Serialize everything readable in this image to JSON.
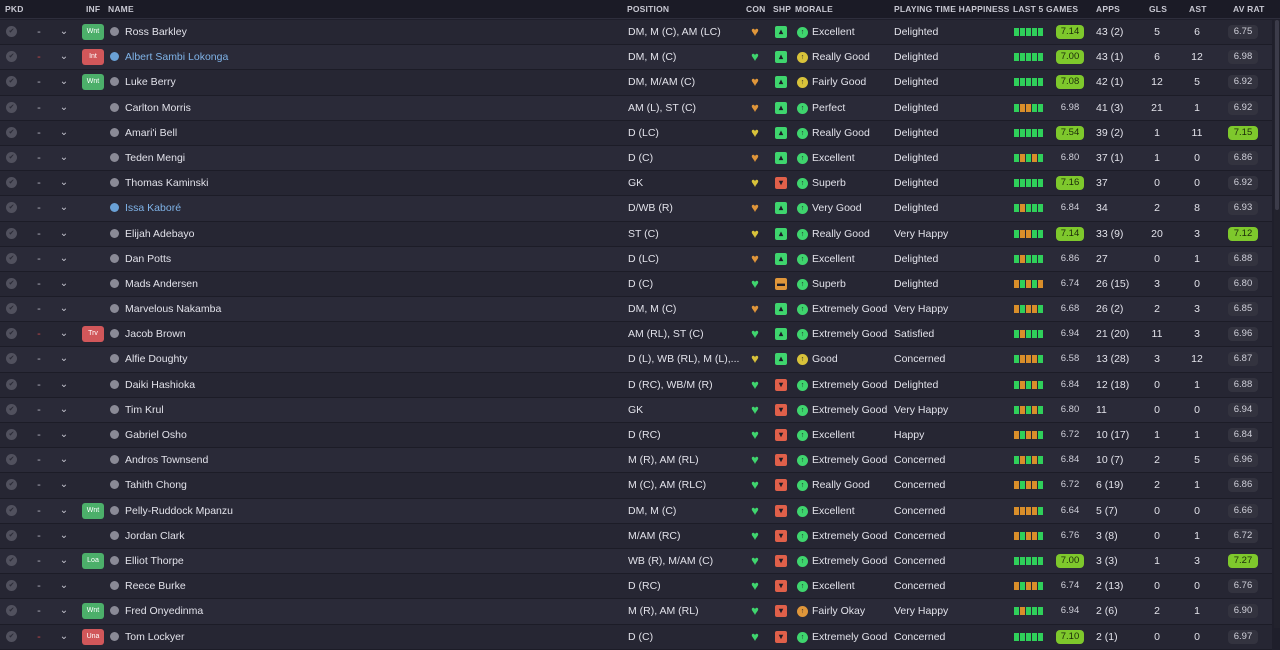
{
  "headers": {
    "pkd": "PKD",
    "inf": "INF",
    "name": "NAME",
    "position": "POSITION",
    "con": "CON",
    "shp": "SHP",
    "morale": "MORALE",
    "pth": "PLAYING TIME HAPPINESS",
    "last5": "LAST 5 GAMES",
    "apps": "APPS",
    "gls": "GLS",
    "ast": "AST",
    "avrat": "AV RAT"
  },
  "colors": {
    "form_green": "#2fd05a",
    "form_orange": "#d98e2a",
    "rating_green": "#7ec82c",
    "inf_green": "#4caf6a",
    "inf_red": "#d1575a",
    "link_blue": "#7fb3e8"
  },
  "players": [
    {
      "dash": "-",
      "dash_red": false,
      "inf": "Wnt",
      "inf_color": "green",
      "name": "Ross Barkley",
      "name_blue": false,
      "position": "DM, M (C), AM (LC)",
      "con": "orange",
      "shp": "green",
      "morale_icon": "green",
      "morale": "Excellent",
      "pth": "Delighted",
      "form": [
        "g",
        "g",
        "g",
        "g",
        "g"
      ],
      "last5": "7.14",
      "last5_green": true,
      "apps": "43 (2)",
      "gls": "5",
      "ast": "6",
      "avrat": "6.75",
      "avrat_green": false
    },
    {
      "dash": "-",
      "dash_red": true,
      "inf": "Int",
      "inf_color": "red",
      "name": "Albert Sambi Lokonga",
      "name_blue": true,
      "position": "DM, M (C)",
      "con": "green",
      "shp": "green",
      "morale_icon": "yellow",
      "morale": "Really Good",
      "pth": "Delighted",
      "form": [
        "g",
        "g",
        "g",
        "g",
        "g"
      ],
      "last5": "7.00",
      "last5_green": true,
      "apps": "43 (1)",
      "gls": "6",
      "ast": "12",
      "avrat": "6.98",
      "avrat_green": false
    },
    {
      "dash": "-",
      "dash_red": false,
      "inf": "Wnt",
      "inf_color": "green",
      "name": "Luke Berry",
      "name_blue": false,
      "position": "DM, M/AM (C)",
      "con": "orange",
      "shp": "green",
      "morale_icon": "yellow",
      "morale": "Fairly Good",
      "pth": "Delighted",
      "form": [
        "g",
        "g",
        "g",
        "g",
        "g"
      ],
      "last5": "7.08",
      "last5_green": true,
      "apps": "42 (1)",
      "gls": "12",
      "ast": "5",
      "avrat": "6.92",
      "avrat_green": false
    },
    {
      "dash": "-",
      "dash_red": false,
      "inf": "",
      "inf_color": "",
      "name": "Carlton Morris",
      "name_blue": false,
      "position": "AM (L), ST (C)",
      "con": "orange",
      "shp": "green",
      "morale_icon": "green",
      "morale": "Perfect",
      "pth": "Delighted",
      "form": [
        "g",
        "o",
        "o",
        "g",
        "g"
      ],
      "last5": "6.98",
      "last5_green": false,
      "apps": "41 (3)",
      "gls": "21",
      "ast": "1",
      "avrat": "6.92",
      "avrat_green": false
    },
    {
      "dash": "-",
      "dash_red": false,
      "inf": "",
      "inf_color": "",
      "name": "Amari'i Bell",
      "name_blue": false,
      "position": "D (LC)",
      "con": "yellow",
      "shp": "green",
      "morale_icon": "green",
      "morale": "Really Good",
      "pth": "Delighted",
      "form": [
        "g",
        "g",
        "g",
        "g",
        "g"
      ],
      "last5": "7.54",
      "last5_green": true,
      "apps": "39 (2)",
      "gls": "1",
      "ast": "11",
      "avrat": "7.15",
      "avrat_green": true
    },
    {
      "dash": "-",
      "dash_red": false,
      "inf": "",
      "inf_color": "",
      "name": "Teden Mengi",
      "name_blue": false,
      "position": "D (C)",
      "con": "orange",
      "shp": "green",
      "morale_icon": "green",
      "morale": "Excellent",
      "pth": "Delighted",
      "form": [
        "g",
        "o",
        "g",
        "o",
        "g"
      ],
      "last5": "6.80",
      "last5_green": false,
      "apps": "37 (1)",
      "gls": "1",
      "ast": "0",
      "avrat": "6.86",
      "avrat_green": false
    },
    {
      "dash": "-",
      "dash_red": false,
      "inf": "",
      "inf_color": "",
      "name": "Thomas Kaminski",
      "name_blue": false,
      "position": "GK",
      "con": "yellow",
      "shp": "red",
      "morale_icon": "green",
      "morale": "Superb",
      "pth": "Delighted",
      "form": [
        "g",
        "g",
        "g",
        "g",
        "g"
      ],
      "last5": "7.16",
      "last5_green": true,
      "apps": "37",
      "gls": "0",
      "ast": "0",
      "avrat": "6.92",
      "avrat_green": false
    },
    {
      "dash": "-",
      "dash_red": false,
      "inf": "",
      "inf_color": "",
      "name": "Issa Kaboré",
      "name_blue": true,
      "position": "D/WB (R)",
      "con": "orange",
      "shp": "green",
      "morale_icon": "green",
      "morale": "Very Good",
      "pth": "Delighted",
      "form": [
        "g",
        "o",
        "g",
        "g",
        "g"
      ],
      "last5": "6.84",
      "last5_green": false,
      "apps": "34",
      "gls": "2",
      "ast": "8",
      "avrat": "6.93",
      "avrat_green": false
    },
    {
      "dash": "-",
      "dash_red": false,
      "inf": "",
      "inf_color": "",
      "name": "Elijah Adebayo",
      "name_blue": false,
      "position": "ST (C)",
      "con": "yellow",
      "shp": "green",
      "morale_icon": "green",
      "morale": "Really Good",
      "pth": "Very Happy",
      "form": [
        "g",
        "o",
        "o",
        "g",
        "g"
      ],
      "last5": "7.14",
      "last5_green": true,
      "apps": "33 (9)",
      "gls": "20",
      "ast": "3",
      "avrat": "7.12",
      "avrat_green": true
    },
    {
      "dash": "-",
      "dash_red": false,
      "inf": "",
      "inf_color": "",
      "name": "Dan Potts",
      "name_blue": false,
      "position": "D (LC)",
      "con": "orange",
      "shp": "green",
      "morale_icon": "green",
      "morale": "Excellent",
      "pth": "Delighted",
      "form": [
        "g",
        "o",
        "g",
        "g",
        "g"
      ],
      "last5": "6.86",
      "last5_green": false,
      "apps": "27",
      "gls": "0",
      "ast": "1",
      "avrat": "6.88",
      "avrat_green": false
    },
    {
      "dash": "-",
      "dash_red": false,
      "inf": "",
      "inf_color": "",
      "name": "Mads Andersen",
      "name_blue": false,
      "position": "D (C)",
      "con": "green",
      "shp": "orange",
      "morale_icon": "green",
      "morale": "Superb",
      "pth": "Delighted",
      "form": [
        "o",
        "g",
        "o",
        "g",
        "o"
      ],
      "last5": "6.74",
      "last5_green": false,
      "apps": "26 (15)",
      "gls": "3",
      "ast": "0",
      "avrat": "6.80",
      "avrat_green": false
    },
    {
      "dash": "-",
      "dash_red": false,
      "inf": "",
      "inf_color": "",
      "name": "Marvelous Nakamba",
      "name_blue": false,
      "position": "DM, M (C)",
      "con": "orange",
      "shp": "green",
      "morale_icon": "green",
      "morale": "Extremely Good",
      "pth": "Very Happy",
      "form": [
        "o",
        "g",
        "o",
        "o",
        "g"
      ],
      "last5": "6.68",
      "last5_green": false,
      "apps": "26 (2)",
      "gls": "2",
      "ast": "3",
      "avrat": "6.85",
      "avrat_green": false
    },
    {
      "dash": "-",
      "dash_red": true,
      "inf": "Trv",
      "inf_color": "red",
      "name": "Jacob Brown",
      "name_blue": false,
      "position": "AM (RL), ST (C)",
      "con": "green",
      "shp": "green",
      "morale_icon": "green",
      "morale": "Extremely Good",
      "pth": "Satisfied",
      "form": [
        "g",
        "o",
        "g",
        "g",
        "g"
      ],
      "last5": "6.94",
      "last5_green": false,
      "apps": "21 (20)",
      "gls": "11",
      "ast": "3",
      "avrat": "6.96",
      "avrat_green": false
    },
    {
      "dash": "-",
      "dash_red": false,
      "inf": "",
      "inf_color": "",
      "name": "Alfie Doughty",
      "name_blue": false,
      "position": "D (L), WB (RL), M (L),...",
      "con": "yellow",
      "shp": "green",
      "morale_icon": "yellow",
      "morale": "Good",
      "pth": "Concerned",
      "form": [
        "g",
        "o",
        "o",
        "o",
        "g"
      ],
      "last5": "6.58",
      "last5_green": false,
      "apps": "13 (28)",
      "gls": "3",
      "ast": "12",
      "avrat": "6.87",
      "avrat_green": false
    },
    {
      "dash": "-",
      "dash_red": false,
      "inf": "",
      "inf_color": "",
      "name": "Daiki Hashioka",
      "name_blue": false,
      "position": "D (RC), WB/M (R)",
      "con": "green",
      "shp": "red",
      "morale_icon": "green",
      "morale": "Extremely Good",
      "pth": "Delighted",
      "form": [
        "g",
        "o",
        "g",
        "o",
        "g"
      ],
      "last5": "6.84",
      "last5_green": false,
      "apps": "12 (18)",
      "gls": "0",
      "ast": "1",
      "avrat": "6.88",
      "avrat_green": false
    },
    {
      "dash": "-",
      "dash_red": false,
      "inf": "",
      "inf_color": "",
      "name": "Tim Krul",
      "name_blue": false,
      "position": "GK",
      "con": "green",
      "shp": "red",
      "morale_icon": "green",
      "morale": "Extremely Good",
      "pth": "Very Happy",
      "form": [
        "g",
        "o",
        "g",
        "o",
        "g"
      ],
      "last5": "6.80",
      "last5_green": false,
      "apps": "11",
      "gls": "0",
      "ast": "0",
      "avrat": "6.94",
      "avrat_green": false
    },
    {
      "dash": "-",
      "dash_red": false,
      "inf": "",
      "inf_color": "",
      "name": "Gabriel Osho",
      "name_blue": false,
      "position": "D (RC)",
      "con": "green",
      "shp": "red",
      "morale_icon": "green",
      "morale": "Excellent",
      "pth": "Happy",
      "form": [
        "o",
        "g",
        "o",
        "o",
        "g"
      ],
      "last5": "6.72",
      "last5_green": false,
      "apps": "10 (17)",
      "gls": "1",
      "ast": "1",
      "avrat": "6.84",
      "avrat_green": false
    },
    {
      "dash": "-",
      "dash_red": false,
      "inf": "",
      "inf_color": "",
      "name": "Andros Townsend",
      "name_blue": false,
      "position": "M (R), AM (RL)",
      "con": "green",
      "shp": "red",
      "morale_icon": "green",
      "morale": "Extremely Good",
      "pth": "Concerned",
      "form": [
        "g",
        "o",
        "g",
        "o",
        "g"
      ],
      "last5": "6.84",
      "last5_green": false,
      "apps": "10 (7)",
      "gls": "2",
      "ast": "5",
      "avrat": "6.96",
      "avrat_green": false
    },
    {
      "dash": "-",
      "dash_red": false,
      "inf": "",
      "inf_color": "",
      "name": "Tahith Chong",
      "name_blue": false,
      "position": "M (C), AM (RLC)",
      "con": "green",
      "shp": "red",
      "morale_icon": "green",
      "morale": "Really Good",
      "pth": "Concerned",
      "form": [
        "o",
        "g",
        "o",
        "o",
        "g"
      ],
      "last5": "6.72",
      "last5_green": false,
      "apps": "6 (19)",
      "gls": "2",
      "ast": "1",
      "avrat": "6.86",
      "avrat_green": false
    },
    {
      "dash": "-",
      "dash_red": false,
      "inf": "Wnt",
      "inf_color": "green",
      "name": "Pelly-Ruddock Mpanzu",
      "name_blue": false,
      "position": "DM, M (C)",
      "con": "green",
      "shp": "red",
      "morale_icon": "green",
      "morale": "Excellent",
      "pth": "Concerned",
      "form": [
        "o",
        "o",
        "o",
        "o",
        "g"
      ],
      "last5": "6.64",
      "last5_green": false,
      "apps": "5 (7)",
      "gls": "0",
      "ast": "0",
      "avrat": "6.66",
      "avrat_green": false
    },
    {
      "dash": "-",
      "dash_red": false,
      "inf": "",
      "inf_color": "",
      "name": "Jordan Clark",
      "name_blue": false,
      "position": "M/AM (RC)",
      "con": "green",
      "shp": "red",
      "morale_icon": "green",
      "morale": "Extremely Good",
      "pth": "Concerned",
      "form": [
        "o",
        "g",
        "o",
        "o",
        "g"
      ],
      "last5": "6.76",
      "last5_green": false,
      "apps": "3 (8)",
      "gls": "0",
      "ast": "1",
      "avrat": "6.72",
      "avrat_green": false
    },
    {
      "dash": "-",
      "dash_red": false,
      "inf": "Loa",
      "inf_color": "green",
      "name": "Elliot Thorpe",
      "name_blue": false,
      "position": "WB (R), M/AM (C)",
      "con": "green",
      "shp": "red",
      "morale_icon": "green",
      "morale": "Extremely Good",
      "pth": "Concerned",
      "form": [
        "g",
        "g",
        "g",
        "g",
        "g"
      ],
      "last5": "7.00",
      "last5_green": true,
      "apps": "3 (3)",
      "gls": "1",
      "ast": "3",
      "avrat": "7.27",
      "avrat_green": true
    },
    {
      "dash": "-",
      "dash_red": false,
      "inf": "",
      "inf_color": "",
      "name": "Reece Burke",
      "name_blue": false,
      "position": "D (RC)",
      "con": "green",
      "shp": "red",
      "morale_icon": "green",
      "morale": "Excellent",
      "pth": "Concerned",
      "form": [
        "o",
        "g",
        "o",
        "o",
        "g"
      ],
      "last5": "6.74",
      "last5_green": false,
      "apps": "2 (13)",
      "gls": "0",
      "ast": "0",
      "avrat": "6.76",
      "avrat_green": false
    },
    {
      "dash": "-",
      "dash_red": false,
      "inf": "Wnt",
      "inf_color": "green",
      "name": "Fred Onyedinma",
      "name_blue": false,
      "position": "M (R), AM (RL)",
      "con": "green",
      "shp": "red",
      "morale_icon": "orange",
      "morale": "Fairly Okay",
      "pth": "Very Happy",
      "form": [
        "g",
        "o",
        "g",
        "g",
        "g"
      ],
      "last5": "6.94",
      "last5_green": false,
      "apps": "2 (6)",
      "gls": "2",
      "ast": "1",
      "avrat": "6.90",
      "avrat_green": false
    },
    {
      "dash": "-",
      "dash_red": true,
      "inf": "Una",
      "inf_color": "red",
      "name": "Tom Lockyer",
      "name_blue": false,
      "position": "D (C)",
      "con": "green",
      "shp": "red",
      "morale_icon": "green",
      "morale": "Extremely Good",
      "pth": "Concerned",
      "form": [
        "g",
        "g",
        "g",
        "g",
        "g"
      ],
      "last5": "7.10",
      "last5_green": true,
      "apps": "2 (1)",
      "gls": "0",
      "ast": "0",
      "avrat": "6.97",
      "avrat_green": false
    }
  ]
}
